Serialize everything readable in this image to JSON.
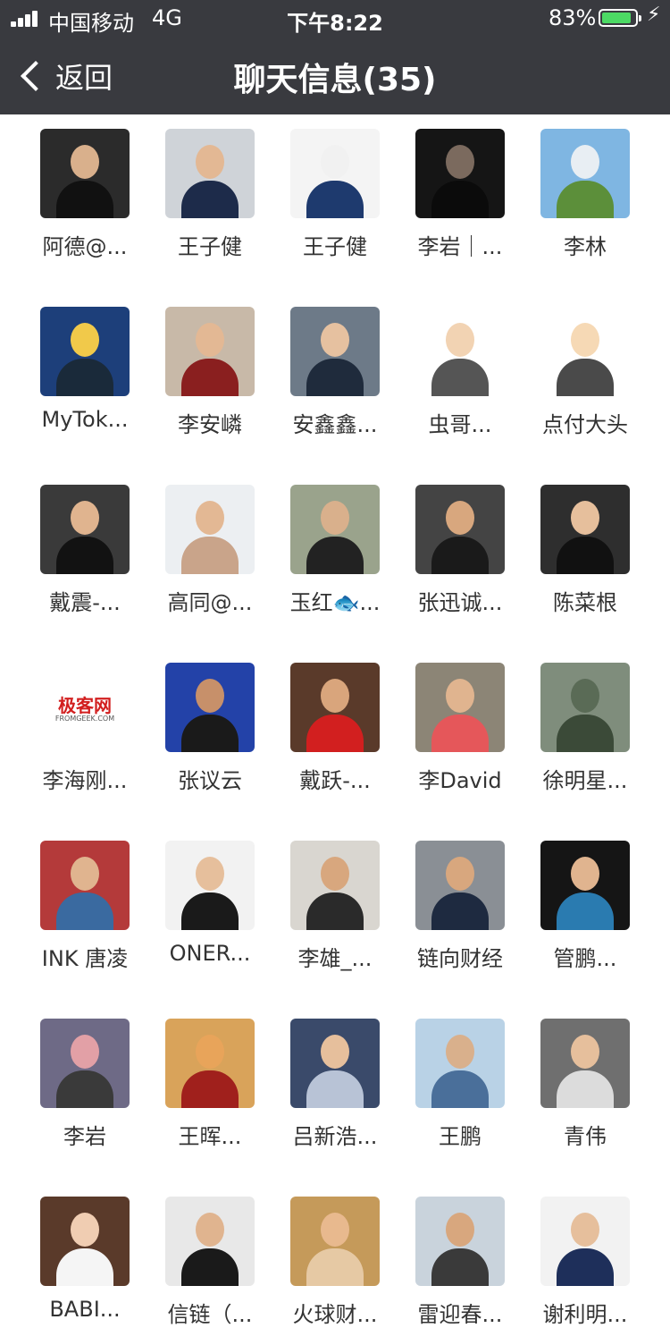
{
  "status": {
    "carrier": "中国移动",
    "network": "4G",
    "time": "下午8:22",
    "battery": "83%"
  },
  "nav": {
    "back_label": "返回",
    "title": "聊天信息(35)"
  },
  "members": [
    {
      "name": "阿德@...",
      "bg": "#2b2b2b",
      "skin": "#d9b08c",
      "suit": "#111111"
    },
    {
      "name": "王子健",
      "bg": "#cfd3d8",
      "skin": "#e3b894",
      "suit": "#1d2b4a"
    },
    {
      "name": "王子健",
      "bg": "#f4f4f4",
      "skin": "#f1f1f1",
      "suit": "#1e3a6e"
    },
    {
      "name": "李岩｜...",
      "bg": "#151515",
      "skin": "#7b6a5e",
      "suit": "#0b0b0b"
    },
    {
      "name": "李林",
      "bg": "#7fb6e2",
      "skin": "#e8eef3",
      "suit": "#5c8f3a"
    },
    {
      "name": "MyTok...",
      "bg": "#1d3f7a",
      "skin": "#f1c94a",
      "suit": "#1a2a3a"
    },
    {
      "name": "李安嶙",
      "bg": "#c8b9a8",
      "skin": "#e3b894",
      "suit": "#8a1f1f"
    },
    {
      "name": "安鑫鑫...",
      "bg": "#6d7a88",
      "skin": "#e6c1a0",
      "suit": "#1f2b3c"
    },
    {
      "name": "虫哥...",
      "bg": "#ffffff",
      "skin": "#f2d3b3",
      "suit": "#555555"
    },
    {
      "name": "点付大头",
      "bg": "#ffffff",
      "skin": "#f6d9b5",
      "suit": "#4a4a4a"
    },
    {
      "name": "戴震-...",
      "bg": "#3a3a3a",
      "skin": "#e0b48f",
      "suit": "#121212"
    },
    {
      "name": "高同@...",
      "bg": "#eceff2",
      "skin": "#e3b894",
      "suit": "#c9a48a"
    },
    {
      "name": "玉红🐟...",
      "bg": "#9aa38c",
      "skin": "#d9b08c",
      "suit": "#222222"
    },
    {
      "name": "张迅诚...",
      "bg": "#444444",
      "skin": "#d8a77e",
      "suit": "#1a1a1a"
    },
    {
      "name": "陈菜根",
      "bg": "#2e2e2e",
      "skin": "#e6bf9c",
      "suit": "#111111"
    },
    {
      "name": "李海刚...",
      "bg": "#ffffff",
      "skin": "#ffffff",
      "suit": "#ffffff",
      "logo": "极客网",
      "logo_sub": "FROMGEEK.COM"
    },
    {
      "name": "张议云",
      "bg": "#2342a8",
      "skin": "#c7906a",
      "suit": "#1a1a1a"
    },
    {
      "name": "戴跃-...",
      "bg": "#5a3a2a",
      "skin": "#d9a57c",
      "suit": "#d21f1f"
    },
    {
      "name": "李David",
      "bg": "#8c8576",
      "skin": "#e0b48f",
      "suit": "#e5575a"
    },
    {
      "name": "徐明星...",
      "bg": "#7f8d7c",
      "skin": "#5a6b56",
      "suit": "#3b4a38"
    },
    {
      "name": "INK 唐凌",
      "bg": "#b43a3a",
      "skin": "#e0b48f",
      "suit": "#3a6aa0"
    },
    {
      "name": "ONER...",
      "bg": "#f2f2f2",
      "skin": "#e6bf9c",
      "suit": "#1a1a1a"
    },
    {
      "name": "李雄_...",
      "bg": "#d9d6d0",
      "skin": "#d8a77e",
      "suit": "#2a2a2a"
    },
    {
      "name": "链向财经",
      "bg": "#8a8f95",
      "skin": "#d8a77e",
      "suit": "#1e2a40"
    },
    {
      "name": "管鹏...",
      "bg": "#151515",
      "skin": "#e0b48f",
      "suit": "#2a7bb0"
    },
    {
      "name": "李岩",
      "bg": "#6e6a86",
      "skin": "#e2a0a6",
      "suit": "#3a3a3a"
    },
    {
      "name": "王晖...",
      "bg": "#d9a35a",
      "skin": "#e8a45a",
      "suit": "#a0201c"
    },
    {
      "name": "吕新浩...",
      "bg": "#3a4a6a",
      "skin": "#e6bf9c",
      "suit": "#b8c3d6"
    },
    {
      "name": "王鹏",
      "bg": "#b9d2e6",
      "skin": "#d9b08c",
      "suit": "#4a6f9a"
    },
    {
      "name": "青伟",
      "bg": "#6f6f6f",
      "skin": "#e6bf9c",
      "suit": "#dcdcdc"
    },
    {
      "name": "BABI...",
      "bg": "#5a3a2a",
      "skin": "#f0cdb2",
      "suit": "#f5f5f5"
    },
    {
      "name": "信链（...",
      "bg": "#e8e8e8",
      "skin": "#e0b48f",
      "suit": "#1a1a1a"
    },
    {
      "name": "火球财...",
      "bg": "#c59a5a",
      "skin": "#e8b98e",
      "suit": "#e6c9a4"
    },
    {
      "name": "雷迎春...",
      "bg": "#c9d3dc",
      "skin": "#d8a77e",
      "suit": "#3a3a3a"
    },
    {
      "name": "谢利明...",
      "bg": "#f2f2f2",
      "skin": "#e6bf9c",
      "suit": "#1e2f5a"
    }
  ]
}
